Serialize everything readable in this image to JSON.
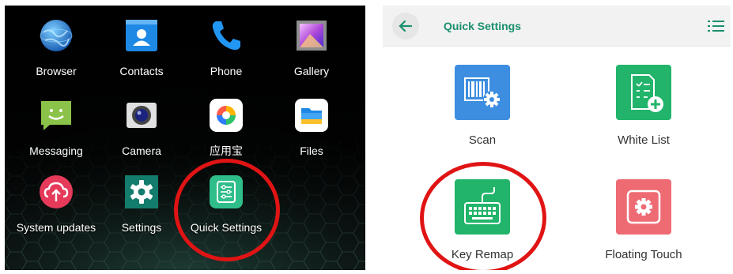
{
  "launcher": {
    "apps": [
      {
        "name": "browser",
        "label": "Browser"
      },
      {
        "name": "contacts",
        "label": "Contacts"
      },
      {
        "name": "phone",
        "label": "Phone"
      },
      {
        "name": "gallery",
        "label": "Gallery"
      },
      {
        "name": "messaging",
        "label": "Messaging"
      },
      {
        "name": "camera",
        "label": "Camera"
      },
      {
        "name": "app-store",
        "label": "应用宝"
      },
      {
        "name": "files",
        "label": "Files"
      },
      {
        "name": "system-updates",
        "label": "System updates"
      },
      {
        "name": "settings",
        "label": "Settings"
      },
      {
        "name": "quick-settings",
        "label": "Quick Settings"
      }
    ]
  },
  "quick_settings": {
    "title": "Quick Settings",
    "tiles": [
      {
        "name": "scan",
        "label": "Scan",
        "color": "#3d8ee0"
      },
      {
        "name": "white-list",
        "label": "White List",
        "color": "#22b46a"
      },
      {
        "name": "key-remap",
        "label": "Key Remap",
        "color": "#22b46a"
      },
      {
        "name": "floating-touch",
        "label": "Floating Touch",
        "color": "#ee6b74"
      }
    ]
  },
  "colors": {
    "highlight_ring": "#e01414",
    "accent": "#1b8f6f"
  }
}
